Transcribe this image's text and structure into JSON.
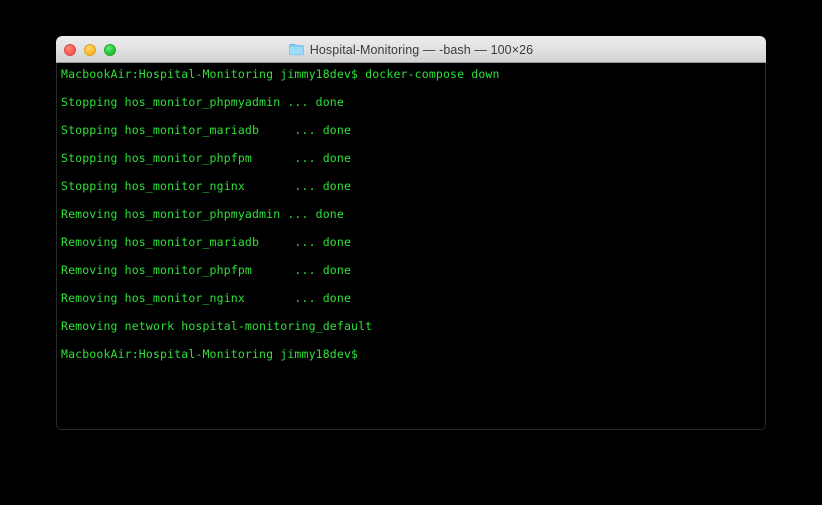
{
  "window": {
    "title": "Hospital-Monitoring — -bash — 100×26",
    "folder_icon": "folder-icon",
    "traffic_lights": [
      {
        "name": "close",
        "color": "#ff5f56"
      },
      {
        "name": "minimize",
        "color": "#ffbd2e"
      },
      {
        "name": "zoom",
        "color": "#28c840"
      }
    ]
  },
  "terminal": {
    "text_color": "#2ee03a",
    "background_color": "#000000",
    "columns": 100,
    "rows": 26,
    "lines": [
      "MacbookAir:Hospital-Monitoring jimmy18dev$ docker-compose down",
      "Stopping hos_monitor_phpmyadmin ... done",
      "Stopping hos_monitor_mariadb     ... done",
      "Stopping hos_monitor_phpfpm      ... done",
      "Stopping hos_monitor_nginx       ... done",
      "Removing hos_monitor_phpmyadmin ... done",
      "Removing hos_monitor_mariadb     ... done",
      "Removing hos_monitor_phpfpm      ... done",
      "Removing hos_monitor_nginx       ... done",
      "Removing network hospital-monitoring_default",
      "MacbookAir:Hospital-Monitoring jimmy18dev$"
    ]
  }
}
